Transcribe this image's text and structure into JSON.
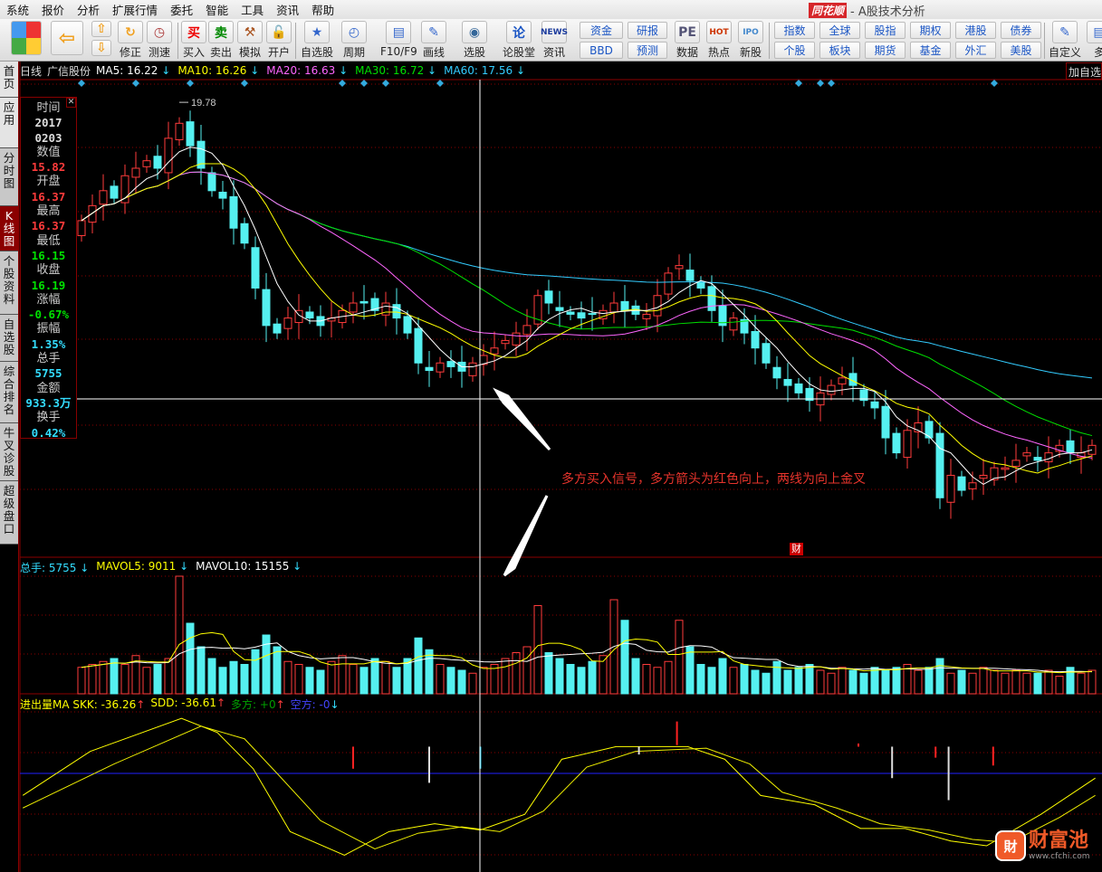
{
  "menu": [
    "系统",
    "报价",
    "分析",
    "扩展行情",
    "委托",
    "智能",
    "工具",
    "资讯",
    "帮助"
  ],
  "title": {
    "logo": "同花顺",
    "text": "- A股技术分析"
  },
  "toolbar": {
    "buttons": [
      {
        "label": "修正",
        "icon": "↻"
      },
      {
        "label": "测速",
        "icon": "◷"
      },
      {
        "label": "买入",
        "icon": "买"
      },
      {
        "label": "卖出",
        "icon": "卖"
      },
      {
        "label": "模拟",
        "icon": "⚒"
      },
      {
        "label": "开户",
        "icon": "🔓"
      },
      {
        "label": "自选股",
        "icon": "★"
      },
      {
        "label": "周期",
        "icon": "◴"
      },
      {
        "label": "F10/F9",
        "icon": "▤"
      },
      {
        "label": "画线",
        "icon": "✎"
      },
      {
        "label": "选股",
        "icon": "◉"
      },
      {
        "label": "论股堂",
        "icon": "论"
      },
      {
        "label": "资讯",
        "icon": "NEWS"
      },
      {
        "label": "数据",
        "icon": "PE"
      },
      {
        "label": "热点",
        "icon": "HOT"
      },
      {
        "label": "新股",
        "icon": "IPO"
      },
      {
        "label": "自定义",
        "icon": "✎"
      },
      {
        "label": "多",
        "icon": "▤"
      }
    ],
    "small": [
      "资金",
      "BBD",
      "研报",
      "预测"
    ],
    "grid": [
      "指数",
      "全球",
      "股指",
      "期权",
      "港股",
      "债券",
      "个股",
      "板块",
      "期货",
      "基金",
      "外汇",
      "美股"
    ]
  },
  "sidetabs": [
    "首页",
    "应用",
    "分时图",
    "K线图",
    "个股资料",
    "自选股",
    "综合排名",
    "牛叉诊股",
    "超级盘口"
  ],
  "header": {
    "period": "日线",
    "stock": "广信股份",
    "ma": [
      {
        "label": "MA5: 16.22",
        "color": "#ffffff"
      },
      {
        "label": "MA10: 16.26",
        "color": "#ffff00"
      },
      {
        "label": "MA20: 16.63",
        "color": "#ff66ff"
      },
      {
        "label": "MA30: 16.72",
        "color": "#00e000"
      },
      {
        "label": "MA60: 17.56",
        "color": "#33ccff"
      }
    ]
  },
  "add_favorite": "加自选",
  "info": [
    {
      "k": "时间",
      "v": "2017",
      "v2": "0203",
      "c": "#dddddd"
    },
    {
      "k": "数值",
      "v": "15.82",
      "c": "#ff3b3b"
    },
    {
      "k": "开盘",
      "v": "16.37",
      "c": "#ff3b3b"
    },
    {
      "k": "最高",
      "v": "16.37",
      "c": "#ff3b3b"
    },
    {
      "k": "最低",
      "v": "16.15",
      "c": "#00e000"
    },
    {
      "k": "收盘",
      "v": "16.19",
      "c": "#00e000"
    },
    {
      "k": "涨幅",
      "v": "-0.67%",
      "c": "#00e000"
    },
    {
      "k": "振幅",
      "v": "1.35%",
      "c": "#33ddff"
    },
    {
      "k": "总手",
      "v": "5755",
      "c": "#33ddff"
    },
    {
      "k": "金额",
      "v": "933.3万",
      "c": "#33ddff"
    },
    {
      "k": "换手",
      "v": "0.42%",
      "c": "#33ddff"
    }
  ],
  "volume_header": [
    {
      "label": "总手: 5755",
      "color": "#33ddff"
    },
    {
      "label": "MAVOL5: 9011",
      "color": "#ffff00"
    },
    {
      "label": "MAVOL10: 15155",
      "color": "#ffffff"
    }
  ],
  "indicator_header": [
    {
      "label": "进出量MA SKK: -36.26",
      "color": "#ffff00",
      "arrow": "↑",
      "ac": "#ff3b3b"
    },
    {
      "label": "SDD: -36.61",
      "color": "#ffff00",
      "arrow": "↑",
      "ac": "#ff3b3b"
    },
    {
      "label": "多方: +0",
      "color": "#00a000",
      "arrow": "↑",
      "ac": "#ff3b3b"
    },
    {
      "label": "空方: -0",
      "color": "#4444ff",
      "arrow": "↓",
      "ac": "#33ddff"
    }
  ],
  "annotation": "多方买入信号，多方箭头为红色向上，两线为向上金叉",
  "fin_marker": "财",
  "watermark": {
    "name": "财富池",
    "url": "www.cfchi.com",
    "badge": "财"
  },
  "colors": {
    "up": "#ff3b3b",
    "down": "#55f0f0",
    "grid": "#8b0000"
  },
  "chart_data": {
    "type": "candlestick",
    "high_label": "19.78",
    "closes": [
      18.2,
      18.4,
      18.6,
      18.5,
      18.8,
      18.9,
      19.0,
      18.9,
      19.3,
      19.5,
      19.2,
      18.9,
      18.6,
      18.5,
      18.1,
      17.9,
      17.3,
      16.8,
      16.7,
      16.9,
      17.0,
      16.9,
      16.8,
      16.9,
      17.0,
      17.1,
      17.1,
      17.0,
      17.1,
      16.9,
      16.7,
      16.3,
      16.2,
      16.3,
      16.25,
      16.19,
      16.3,
      16.4,
      16.5,
      16.6,
      16.7,
      16.8,
      17.2,
      17.1,
      17.0,
      16.95,
      16.9,
      16.95,
      17.0,
      17.1,
      17.0,
      16.95,
      16.95,
      17.2,
      17.5,
      17.6,
      17.4,
      17.3,
      17.0,
      16.8,
      16.9,
      16.7,
      16.5,
      16.3,
      16.1,
      16.0,
      15.9,
      15.8,
      15.9,
      16.0,
      16.1,
      16.0,
      15.8,
      15.7,
      15.3,
      15.1,
      15.4,
      15.5,
      15.3,
      14.5,
      14.8,
      14.6,
      14.7,
      14.8,
      14.9,
      14.9,
      15.0,
      15.1,
      15.0,
      15.1,
      15.2,
      15.1,
      15.1,
      15.2
    ],
    "volumes": [
      9000,
      10000,
      11000,
      12000,
      10000,
      13000,
      9000,
      10000,
      12000,
      40000,
      24000,
      16000,
      12000,
      9000,
      11000,
      10000,
      15000,
      20000,
      16000,
      11000,
      10000,
      9000,
      8000,
      11000,
      13000,
      10000,
      9000,
      12000,
      11000,
      9000,
      12000,
      19000,
      15000,
      10000,
      9000,
      8000,
      7000,
      9000,
      10000,
      12000,
      14000,
      16000,
      30000,
      14000,
      12000,
      10000,
      9000,
      11000,
      13000,
      32000,
      25000,
      12000,
      10000,
      9000,
      11000,
      25000,
      16000,
      10000,
      9000,
      12000,
      9000,
      10000,
      8000,
      7000,
      11000,
      8000,
      9000,
      10000,
      8000,
      7000,
      9000,
      8000,
      7000,
      9000,
      8000,
      9000,
      10000,
      8000,
      9000,
      12000,
      7000,
      8000,
      7000,
      9000,
      8000,
      7000,
      8000,
      7000,
      7000,
      8000,
      6000,
      9000,
      7000,
      8000
    ],
    "event_markers_index": [
      0,
      5,
      10,
      15,
      24,
      26,
      28,
      33,
      66,
      68,
      69,
      84
    ],
    "skk": [
      [
        -5.4,
        -14
      ],
      [
        0.8,
        14
      ],
      [
        9.2,
        35
      ],
      [
        12.5,
        26
      ],
      [
        15.8,
        3
      ],
      [
        19.2,
        -37
      ],
      [
        24.2,
        -52
      ],
      [
        28.3,
        -37
      ],
      [
        32.5,
        -32
      ],
      [
        36.7,
        -36
      ],
      [
        40.8,
        -26
      ],
      [
        44.2,
        9
      ],
      [
        49.2,
        17
      ],
      [
        55.8,
        17
      ],
      [
        59.2,
        9
      ],
      [
        62.5,
        -14
      ],
      [
        67.5,
        -20
      ],
      [
        71.7,
        -35
      ],
      [
        75.8,
        -35
      ],
      [
        80,
        -43
      ],
      [
        83.3,
        -46
      ],
      [
        88.3,
        -26
      ],
      [
        93.3,
        -3
      ]
    ],
    "sdd": [
      [
        -5.4,
        -22
      ],
      [
        3,
        6
      ],
      [
        11,
        30
      ],
      [
        15,
        22
      ],
      [
        18,
        0
      ],
      [
        22,
        -30
      ],
      [
        27,
        -48
      ],
      [
        31,
        -38
      ],
      [
        35,
        -34
      ],
      [
        38.5,
        -37
      ],
      [
        42.5,
        -24
      ],
      [
        46.5,
        4
      ],
      [
        51,
        14
      ],
      [
        57.5,
        16
      ],
      [
        61.5,
        6
      ],
      [
        64.5,
        -12
      ],
      [
        69.5,
        -22
      ],
      [
        73.5,
        -32
      ],
      [
        78,
        -36
      ],
      [
        82,
        -42
      ],
      [
        85.5,
        -44
      ],
      [
        90,
        -28
      ],
      [
        93.3,
        -14
      ]
    ],
    "signals": [
      {
        "i": 25,
        "from": 17,
        "to": 3,
        "color": "#ff2222"
      },
      {
        "i": 32,
        "from": 17,
        "to": -6,
        "color": "#dddddd"
      },
      {
        "i": 36.7,
        "from": 17,
        "to": 3,
        "color": "#33ddff"
      },
      {
        "i": 51.3,
        "from": 17,
        "to": 12,
        "color": "#dddddd"
      },
      {
        "i": 54.8,
        "from": 33,
        "to": 18,
        "color": "#ff2222"
      },
      {
        "i": 71.5,
        "from": 19,
        "to": 17,
        "color": "#ff2222"
      },
      {
        "i": 74.6,
        "from": 17,
        "to": -3,
        "color": "#dddddd"
      },
      {
        "i": 78.6,
        "from": 17,
        "to": 10,
        "color": "#ff2222"
      },
      {
        "i": 79.8,
        "from": 17,
        "to": -17,
        "color": "#dddddd"
      },
      {
        "i": 83.9,
        "from": 17,
        "to": 5,
        "color": "#ff2222"
      }
    ],
    "crosshair": {
      "price": 15.82
    }
  }
}
